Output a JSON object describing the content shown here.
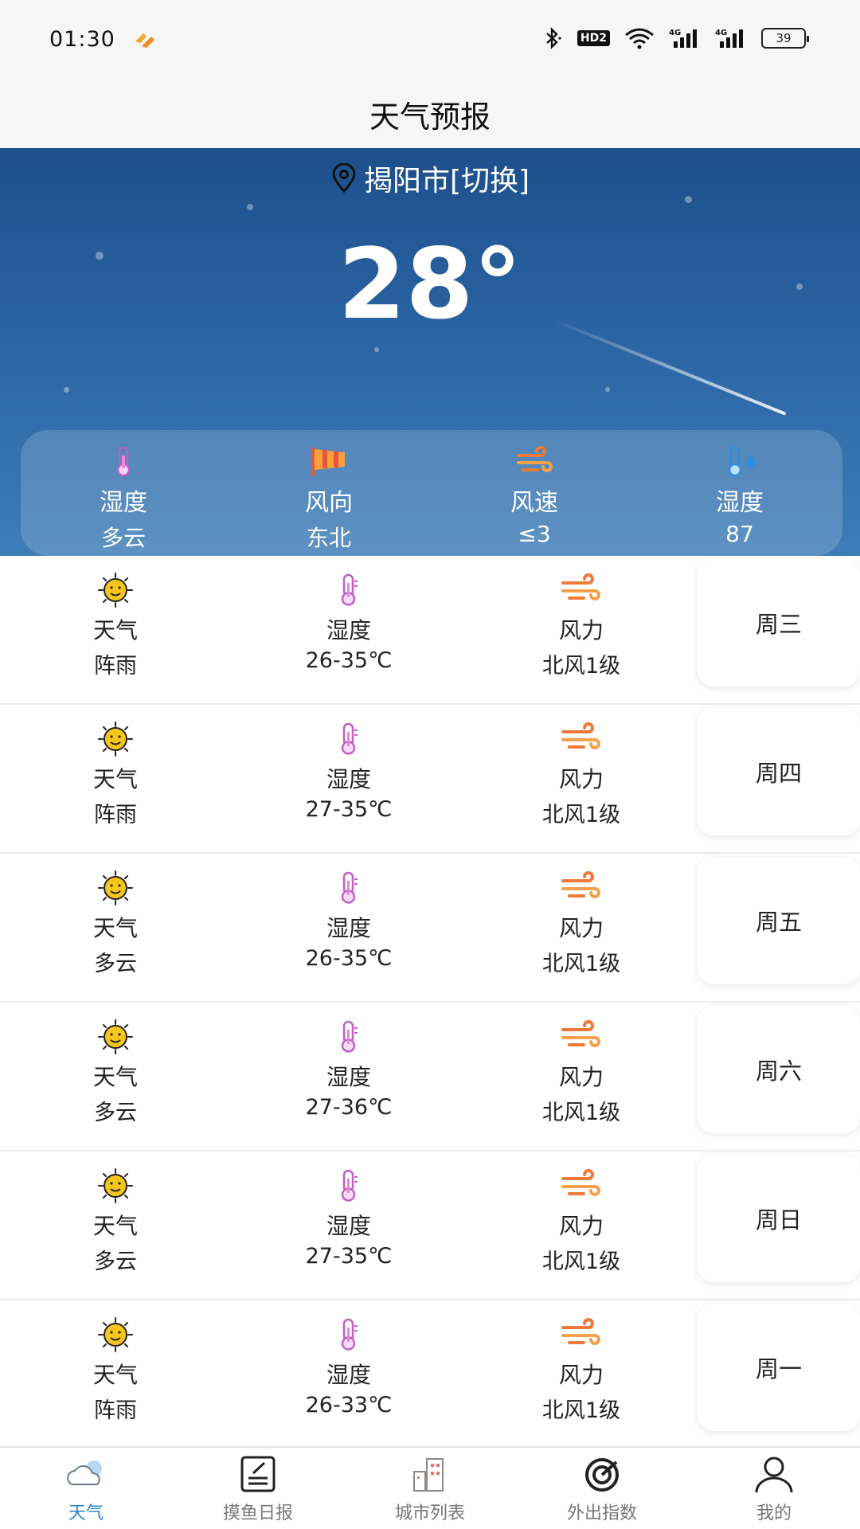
{
  "status": {
    "time": "01:30",
    "hd": "HD2",
    "battery": "39"
  },
  "header": {
    "title": "天气预报"
  },
  "hero": {
    "location": "揭阳市[切换]",
    "temperature": "28°",
    "metrics": [
      {
        "label": "湿度",
        "value": "多云",
        "icon": "thermometer-icon"
      },
      {
        "label": "风向",
        "value": "东北",
        "icon": "windsock-icon"
      },
      {
        "label": "风速",
        "value": "≤3",
        "icon": "wind-icon"
      },
      {
        "label": "湿度",
        "value": "87",
        "icon": "humidity-icon"
      }
    ]
  },
  "forecast": [
    {
      "weather_label": "天气",
      "weather": "阵雨",
      "temp_label": "湿度",
      "temp": "26-35℃",
      "wind_label": "风力",
      "wind": "北风1级",
      "day": "周三"
    },
    {
      "weather_label": "天气",
      "weather": "阵雨",
      "temp_label": "湿度",
      "temp": "27-35℃",
      "wind_label": "风力",
      "wind": "北风1级",
      "day": "周四"
    },
    {
      "weather_label": "天气",
      "weather": "多云",
      "temp_label": "湿度",
      "temp": "26-35℃",
      "wind_label": "风力",
      "wind": "北风1级",
      "day": "周五"
    },
    {
      "weather_label": "天气",
      "weather": "多云",
      "temp_label": "湿度",
      "temp": "27-36℃",
      "wind_label": "风力",
      "wind": "北风1级",
      "day": "周六"
    },
    {
      "weather_label": "天气",
      "weather": "多云",
      "temp_label": "湿度",
      "temp": "27-35℃",
      "wind_label": "风力",
      "wind": "北风1级",
      "day": "周日"
    },
    {
      "weather_label": "天气",
      "weather": "阵雨",
      "temp_label": "湿度",
      "temp": "26-33℃",
      "wind_label": "风力",
      "wind": "北风1级",
      "day": "周一"
    }
  ],
  "nav": [
    {
      "label": "天气",
      "icon": "cloud-icon",
      "active": true
    },
    {
      "label": "摸鱼日报",
      "icon": "notepad-icon",
      "active": false
    },
    {
      "label": "城市列表",
      "icon": "buildings-icon",
      "active": false
    },
    {
      "label": "外出指数",
      "icon": "radar-icon",
      "active": false
    },
    {
      "label": "我的",
      "icon": "person-icon",
      "active": false
    }
  ],
  "colors": {
    "accent": "#2b86c8",
    "hero_top": "#1d4f8c",
    "hero_bottom": "#3e7db8",
    "wind_icon": "#f07a3a",
    "thermo_icon": "#c15fc4"
  }
}
